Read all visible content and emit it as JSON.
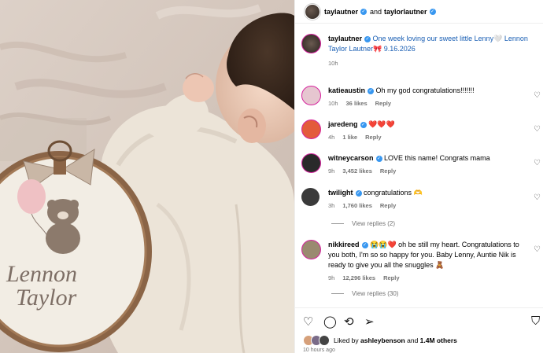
{
  "photo": {
    "embroidery_text_line1": "Lennon",
    "embroidery_text_line2": "Taylor"
  },
  "header": {
    "user1": "taylautner",
    "joiner": "and",
    "user2": "taylorlautner"
  },
  "caption": {
    "user": "taylautner",
    "text": "One week loving our sweet little Lenny🤍 Lennon Taylor Lautner🎀 9.16.2026",
    "time": "10h"
  },
  "comments": [
    {
      "user": "katieaustin",
      "text": "Oh my god congratulations!!!!!!!",
      "time": "10h",
      "likes": "36 likes",
      "reply": "Reply",
      "avatar_color": "#e6c6d0"
    },
    {
      "user": "jaredeng",
      "text": "❤️❤️❤️",
      "time": "4h",
      "likes": "1 like",
      "reply": "Reply",
      "avatar_color": "#e35b3b"
    },
    {
      "user": "witneycarson",
      "text": "LOVE this name! Congrats mama",
      "time": "9h",
      "likes": "3,452 likes",
      "reply": "Reply",
      "avatar_color": "#2a2a2a"
    },
    {
      "user": "twilight",
      "text": "congratulations 🫶",
      "time": "3h",
      "likes": "1,760 likes",
      "reply": "Reply",
      "avatar_color": "#3a3a3a"
    },
    {
      "user": "nikkireed",
      "text": "😭😭❤️ oh be still my heart. Congratulations to you both, I'm so so happy for you. Baby Lenny, Auntie Nik is ready to give you all the snuggles 🧸",
      "time": "9h",
      "likes": "12,296 likes",
      "reply": "Reply",
      "avatar_color": "#9a8a70"
    }
  ],
  "view_replies": [
    {
      "label": "View replies (2)"
    },
    {
      "label": "View replies (30)"
    }
  ],
  "liked_by": {
    "prefix": "Liked by",
    "user": "ashleybenson",
    "and": "and",
    "others": "1.4M others"
  },
  "timestamp": "10 hours ago",
  "icons": {
    "like": "heart-icon",
    "comment": "comment-icon",
    "share": "repost-icon",
    "send": "send-icon",
    "save": "bookmark-icon"
  }
}
